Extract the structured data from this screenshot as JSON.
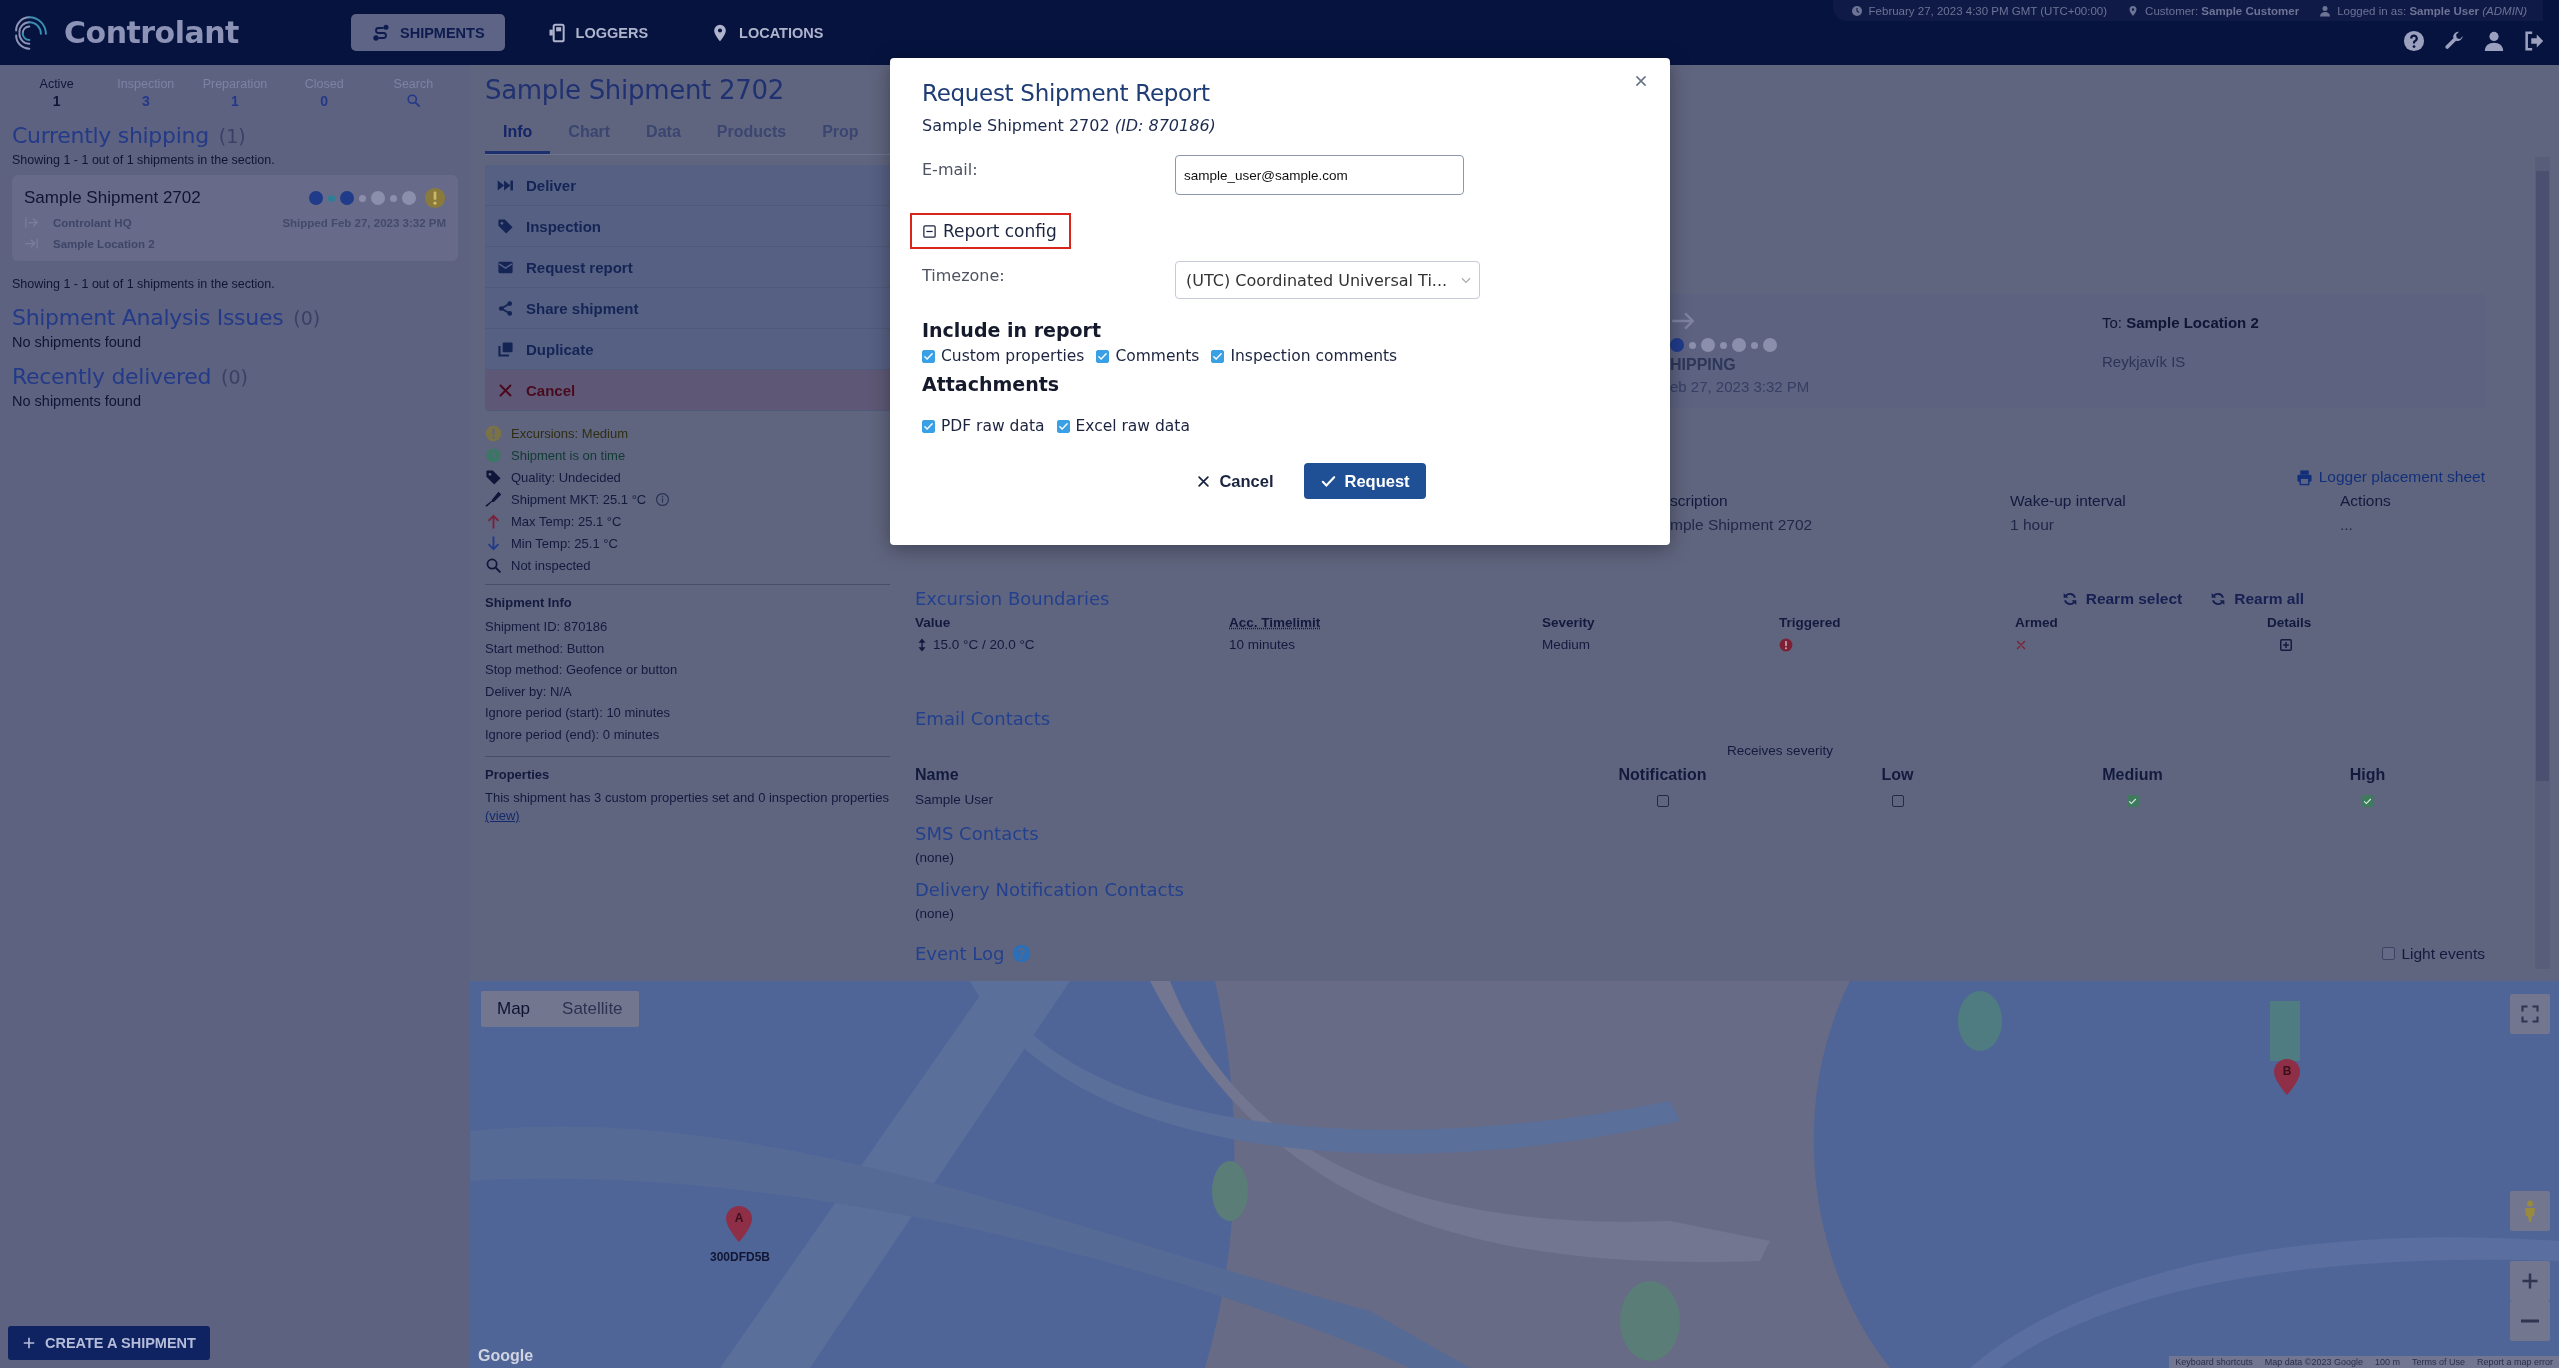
{
  "header": {
    "logo": "Controlant",
    "nav": [
      {
        "label": "SHIPMENTS",
        "kind": "shipments",
        "selected": true
      },
      {
        "label": "LOGGERS",
        "kind": "loggers",
        "selected": false
      },
      {
        "label": "LOCATIONS",
        "kind": "locations",
        "selected": false
      }
    ],
    "status": {
      "datetime": "February 27, 2023 4:30 PM GMT (UTC+00:00)",
      "customer_label": "Customer:",
      "customer": "Sample Customer",
      "login_label": "Logged in as:",
      "user": "Sample User",
      "role": "(ADMIN)"
    }
  },
  "sidebar": {
    "tabs": [
      {
        "label": "Active",
        "count": "1",
        "selected": true
      },
      {
        "label": "Inspection",
        "count": "3",
        "selected": false
      },
      {
        "label": "Preparation",
        "count": "1",
        "selected": false
      },
      {
        "label": "Closed",
        "count": "0",
        "selected": false
      },
      {
        "label": "Search",
        "kind": "search",
        "selected": false
      }
    ],
    "sections": [
      {
        "title": "Currently shipping",
        "count": "(1)",
        "summary": "Showing 1 - 1 out of 1 shipments in the section.",
        "shipments": [
          {
            "name": "Sample Shipment 2702",
            "stages": [
              {
                "done": true
              },
              {
                "done": true
              },
              {
                "done": false
              },
              {
                "done": false
              }
            ],
            "warning": true,
            "from": "Controlant HQ",
            "to": "Sample Location 2",
            "shipped": "Shipped Feb 27, 2023 3:32 PM"
          }
        ],
        "footer": "Showing 1 - 1 out of 1 shipments in the section."
      },
      {
        "title": "Shipment Analysis Issues",
        "count": "(0)",
        "empty": "No shipments found"
      },
      {
        "title": "Recently delivered",
        "count": "(0)",
        "empty": "No shipments found"
      }
    ],
    "create_button": "CREATE A SHIPMENT"
  },
  "info": {
    "title": "Sample Shipment 2702",
    "tabs": [
      {
        "label": "Info",
        "selected": true
      },
      {
        "label": "Chart",
        "selected": false
      },
      {
        "label": "Data",
        "selected": false
      },
      {
        "label": "Products",
        "selected": false
      },
      {
        "label": "Prop",
        "selected": false
      }
    ],
    "actions": [
      {
        "kind": "deliver",
        "label": "Deliver"
      },
      {
        "kind": "inspection",
        "label": "Inspection"
      },
      {
        "kind": "report",
        "label": "Request report"
      },
      {
        "kind": "share",
        "label": "Share shipment"
      },
      {
        "kind": "duplicate",
        "label": "Duplicate"
      },
      {
        "kind": "cancel",
        "label": "Cancel"
      }
    ],
    "status": [
      {
        "kind": "excursion",
        "text": "Excursions: Medium"
      },
      {
        "kind": "ontime",
        "text": "Shipment is on time"
      },
      {
        "kind": "quality",
        "text": "Quality: Undecided"
      },
      {
        "kind": "mkt",
        "text": "Shipment MKT: 25.1 °C",
        "info": true
      },
      {
        "kind": "max",
        "text": "Max Temp: 25.1 °C"
      },
      {
        "kind": "min",
        "text": "Min Temp: 25.1 °C"
      },
      {
        "kind": "inspected",
        "text": "Not inspected"
      }
    ],
    "shipment_info": {
      "title": "Shipment Info",
      "lines": [
        "Shipment ID: 870186",
        "Start method: Button",
        "Stop method: Geofence or button",
        "Deliver by: N/A",
        "Ignore period (start): 10 minutes",
        "Ignore period (end): 0 minutes"
      ]
    },
    "properties": {
      "title": "Properties",
      "text": "This shipment has 3 custom properties set and 0 inspection properties",
      "link": "(view)"
    }
  },
  "overview": {
    "stages": [
      {
        "done": true
      },
      {
        "done": false
      },
      {
        "done": false
      },
      {
        "done": false
      }
    ],
    "status": "HIPPING",
    "date": "eb 27, 2023 3:32 PM",
    "to_label": "To:",
    "to": "Sample Location 2",
    "city": "Reykjavík IS",
    "link": "Logger placement sheet",
    "columns": [
      "scription",
      "Wake-up interval",
      "Actions"
    ],
    "rows": [
      [
        "mple Shipment 2702",
        "1 hour",
        "..."
      ]
    ]
  },
  "excursions": {
    "title": "Excursion Boundaries",
    "buttons": [
      "Rearm select",
      "Rearm all"
    ],
    "columns": [
      {
        "label": "Value",
        "abbr": false
      },
      {
        "label": "Acc. Timelimit",
        "abbr": true
      },
      {
        "label": "Severity",
        "abbr": false
      },
      {
        "label": "Triggered",
        "abbr": false
      },
      {
        "label": "Armed",
        "abbr": false
      },
      {
        "label": "Details",
        "abbr": false
      }
    ],
    "rows": [
      {
        "value": "15.0 °C / 20.0 °C",
        "timelimit": "10 minutes",
        "severity": "Medium",
        "triggered": true,
        "armed": false
      }
    ]
  },
  "email": {
    "title": "Email Contacts",
    "group_label": "Receives severity",
    "columns": [
      "Name",
      "Notification",
      "Low",
      "Medium",
      "High"
    ],
    "rows": [
      {
        "name": "Sample User",
        "checks": [
          {
            "checked": false
          },
          {
            "checked": false
          },
          {
            "checked": true
          },
          {
            "checked": true
          }
        ]
      }
    ]
  },
  "sms": {
    "title": "SMS Contacts",
    "empty": "(none)"
  },
  "delivery": {
    "title": "Delivery Notification Contacts",
    "empty": "(none)"
  },
  "event_log": {
    "title": "Event Log",
    "toggle": {
      "label": "Light events",
      "checked": false
    }
  },
  "map": {
    "tabs": [
      {
        "label": "Map",
        "selected": true
      },
      {
        "label": "Satellite",
        "selected": false
      }
    ],
    "markers": [
      {
        "letter": "A",
        "label": "300DFD5B"
      },
      {
        "letter": "B"
      }
    ],
    "logo": "Google",
    "attribution": [
      "Keyboard shortcuts",
      "Map data ©2023 Google",
      "100 m",
      "Terms of Use",
      "Report a map error"
    ]
  },
  "dialog": {
    "title": "Request Shipment Report",
    "subtitle": "Sample Shipment 2702 *(ID: 870186)*",
    "email": {
      "label": "E-mail:",
      "value": "sample_user@sample.com"
    },
    "config": {
      "label": "Report config",
      "expanded": true,
      "highlighted": true
    },
    "timezone": {
      "label": "Timezone:",
      "value": "(UTC) Coordinated Universal Ti..."
    },
    "include": {
      "title": "Include in report",
      "options": [
        {
          "label": "Custom properties",
          "checked": true
        },
        {
          "label": "Comments",
          "checked": true
        },
        {
          "label": "Inspection comments",
          "checked": true
        }
      ]
    },
    "attachments": {
      "title": "Attachments",
      "options": [
        {
          "label": "PDF raw data",
          "checked": true
        },
        {
          "label": "Excel raw data",
          "checked": true
        }
      ]
    },
    "buttons": {
      "cancel": "Cancel",
      "submit": "Request"
    }
  }
}
